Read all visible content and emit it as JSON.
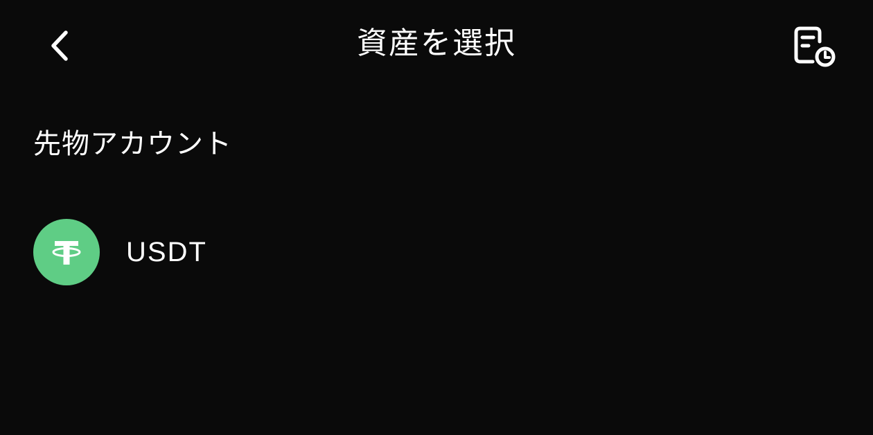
{
  "header": {
    "title": "資産を選択",
    "back_icon": "chevron-left-icon",
    "history_icon": "document-clock-icon"
  },
  "section": {
    "label": "先物アカウント"
  },
  "assets": [
    {
      "symbol": "USDT",
      "icon": "tether-icon",
      "icon_color": "#5fcd85"
    }
  ],
  "colors": {
    "background": "#0a0a0a",
    "text": "#ffffff",
    "accent": "#5fcd85"
  }
}
